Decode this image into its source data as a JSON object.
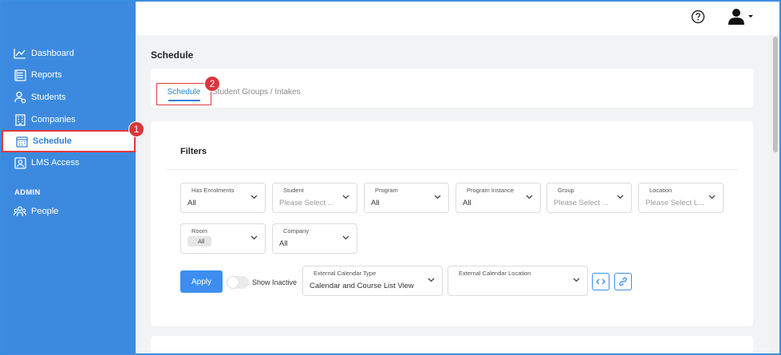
{
  "sidebar": {
    "items": [
      {
        "label": "Dashboard",
        "icon": "chart-line-icon"
      },
      {
        "label": "Reports",
        "icon": "report-icon"
      },
      {
        "label": "Students",
        "icon": "students-icon"
      },
      {
        "label": "Companies",
        "icon": "building-icon"
      },
      {
        "label": "Schedule",
        "icon": "calendar-icon",
        "active": true
      },
      {
        "label": "LMS Access",
        "icon": "lms-icon"
      }
    ],
    "section_label": "ADMIN",
    "admin_items": [
      {
        "label": "People",
        "icon": "people-icon"
      }
    ]
  },
  "badges": {
    "one": "1",
    "two": "2"
  },
  "header": {
    "help_icon": "help-circle-icon",
    "user_icon": "user-icon"
  },
  "page": {
    "title": "Schedule"
  },
  "tabs": [
    {
      "label": "Schedule",
      "active": true
    },
    {
      "label": "Student Groups / Intakes",
      "active": false
    }
  ],
  "filters": {
    "title": "Filters",
    "fields": [
      {
        "label": "Has Enrolments",
        "value": "All"
      },
      {
        "label": "Student",
        "placeholder": "Please Select ..."
      },
      {
        "label": "Program",
        "value": "All"
      },
      {
        "label": "Program Instance",
        "value": "All"
      },
      {
        "label": "Group",
        "placeholder": "Please Select ..."
      },
      {
        "label": "Location",
        "placeholder": "Please Select L..."
      },
      {
        "label": "Room",
        "chip": "All"
      },
      {
        "label": "Company",
        "value": "All"
      }
    ],
    "apply_label": "Apply",
    "show_inactive_label": "Show Inactive",
    "external_calendar_type": {
      "label": "External Calendar Type",
      "value": "Calendar and Course List View"
    },
    "external_calendar_location": {
      "label": "External Calendar Location",
      "value": ""
    }
  },
  "colors": {
    "sidebar": "#3c8ae0",
    "accent": "#3d8ef0",
    "highlight": "#e0393e"
  }
}
